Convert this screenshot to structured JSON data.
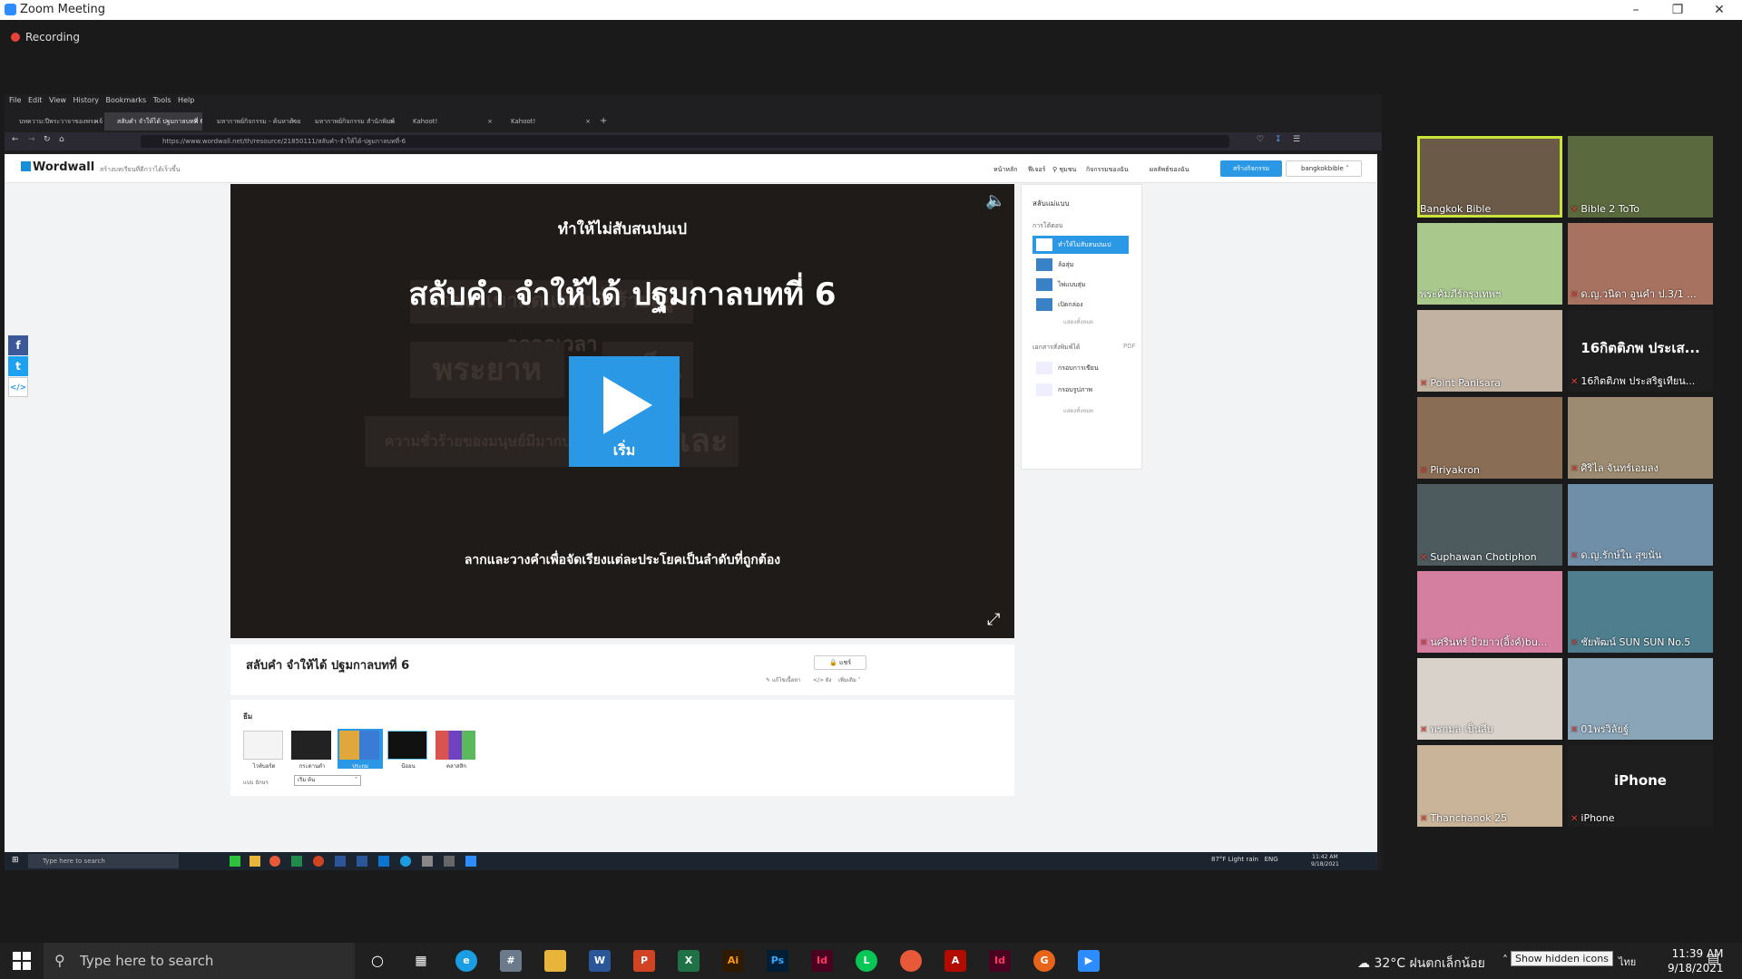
{
  "zoom": {
    "title": "Zoom Meeting",
    "recording": "Recording"
  },
  "browser": {
    "menu": [
      "File",
      "Edit",
      "View",
      "History",
      "Bookmarks",
      "Tools",
      "Help"
    ],
    "tabs": [
      {
        "label": "บทความ:ปีพระวาจาของพระเจ้า"
      },
      {
        "label": "สลับคำ จำให้ได้ ปฐมกาลบทที่ 6"
      },
      {
        "label": "มหากาพย์กิจกรรม - ค้นหาด้วย"
      },
      {
        "label": "มหากาพย์กิจกรรม สำนักพิมพ์"
      },
      {
        "label": "Kahoot!"
      },
      {
        "label": "Kahoot!"
      }
    ],
    "url": "https://www.wordwall.net/th/resource/21850111/สลับคำ-จำให้ได้-ปฐมกาลบทที่-6"
  },
  "wordwall": {
    "logo": "Wordwall",
    "tagline": "สร้างบทเรียนที่ดีกว่าได้เร็วขึ้น",
    "nav": [
      "หน้าหลัก",
      "ฟีเจอร์",
      "ชุมชน",
      "กิจกรรมของฉัน",
      "ผลลัพธ์ของฉัน"
    ],
    "create": "สร้างกิจกรรม",
    "user": "bangkokbible"
  },
  "game": {
    "subtitle": "ทำให้ไม่สับสนปนเป",
    "title": "สลับคำ จำให้ได้ ปฐมกาลบทที่ 6",
    "play": "เริ่ม",
    "instruction": "ลากและวางคำเพื่อจัดเรียงแต่ละประโยคเป็นลำดับที่ถูกต้อง",
    "ghost": [
      "ใจของเขาคิดแต่สิ่งชั่วร้ายอยู่ตลอดเวลา",
      "พระยาห",
      "งเห็นว่า",
      "ความชั่วร้ายของมนุษย์มีมากบนแผ่นดิน",
      "และ"
    ]
  },
  "side": {
    "switch": "สลับแม่แบบ",
    "interactive": "การโต้ตอบ",
    "templates": [
      "ทำให้ไม่สับสนปนเป",
      "ล้อสุ่ม",
      "ไพ่แบบสุ่ม",
      "เปิดกล่อง"
    ],
    "more1": "แสดงทั้งหมด",
    "printable": "เอกสารสั่งพิมพ์ได้",
    "pdf": "PDF",
    "prints": [
      "กรอบการเขียน",
      "กรอบรูปภาพ"
    ],
    "more2": "แสดงทั้งหมด"
  },
  "info": {
    "title": "สลับคำ จำให้ได้ ปฐมกาลบทที่ 6",
    "share": "แชร์",
    "edit": "แก้ไขเนื้อหา",
    "embed": "ฝัง",
    "more": "เพิ่มเติม"
  },
  "themes": {
    "heading": "ธีม",
    "items": [
      "ไวท์บอร์ด",
      "กระดานดำ",
      "ประถม",
      "นีออน",
      "คลาสสิก"
    ],
    "font_label": "แบบ อักษร",
    "font_value": "เริ่ม ต้น"
  },
  "inner_taskbar": {
    "search": "Type here to search",
    "weather": "87°F  Light rain",
    "lang": "ENG",
    "time": "11:42 AM",
    "date": "9/18/2021"
  },
  "participants": [
    {
      "name": "Bangkok Bible",
      "muted": false
    },
    {
      "name": "Bible 2 ToTo",
      "muted": true
    },
    {
      "name": "พระคัมภีร์กรุงเทพฯ",
      "muted": false
    },
    {
      "name": "ด.ญ.วนิดา อูนคำ ป.3/1 ...",
      "muted": true
    },
    {
      "name": "Point Panisara",
      "muted": true
    },
    {
      "name": "16กิตติภพ ประสริฐเทียน...",
      "muted": true,
      "big": "16กิตติภพ ประเส..."
    },
    {
      "name": "Piriyakron",
      "muted": true
    },
    {
      "name": "ศิริไล จันทร์เอมลง",
      "muted": true
    },
    {
      "name": "Suphawan Chotiphon",
      "muted": true
    },
    {
      "name": "ด.ญ.รักษ์ใน สุขนั่น",
      "muted": true
    },
    {
      "name": "นศรินทร์ ปัวยาว(อิ้งค์)bu...",
      "muted": true
    },
    {
      "name": "ชัยพัฒน์ SUN SUN No.5",
      "muted": true
    },
    {
      "name": "พรกมล เป็นสีบ",
      "muted": true
    },
    {
      "name": "01พรวิลัยฐ์",
      "muted": true
    },
    {
      "name": "Thanchanok 25",
      "muted": true
    },
    {
      "name": "iPhone",
      "muted": true,
      "big": "iPhone"
    }
  ],
  "taskbar": {
    "search": "Type here to search",
    "weather": "32°C  ฝนตกเล็กน้อย",
    "tooltip": "Show hidden icons",
    "time": "11:39 AM",
    "date": "9/18/2021",
    "lang": "ไทย"
  },
  "colors": {
    "zoom_blue": "#2D8CFF",
    "wordwall_blue": "#2b98e5",
    "active_speaker": "#c8e43a",
    "muted_red": "#e8413a"
  }
}
